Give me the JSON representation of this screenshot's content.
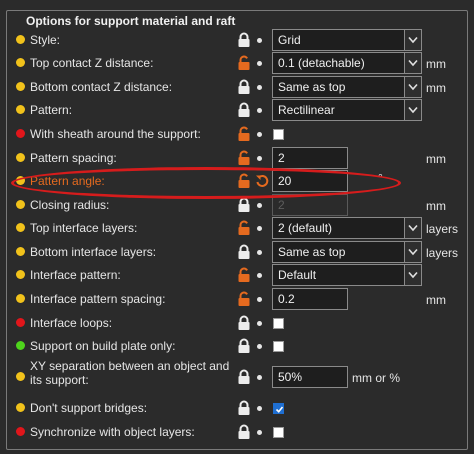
{
  "group_title": "Options for support material and raft",
  "colors": {
    "simple": "#f1c21b",
    "advanced": "#e1161b",
    "expert": "#4ed41c",
    "modified": "#e56a1f"
  },
  "rows": [
    {
      "label": "Style:",
      "dot": "simple",
      "lock": "locked",
      "control": "combo",
      "value": "Grid"
    },
    {
      "label": "Top contact Z distance:",
      "dot": "simple",
      "lock": "unlocked",
      "control": "combo",
      "value": "0.1 (detachable)",
      "unit": "mm"
    },
    {
      "label": "Bottom contact Z distance:",
      "dot": "simple",
      "lock": "locked",
      "control": "combo",
      "value": "Same as top",
      "unit": "mm"
    },
    {
      "label": "Pattern:",
      "dot": "simple",
      "lock": "locked",
      "control": "combo",
      "value": "Rectilinear"
    },
    {
      "label": "With sheath around the support:",
      "dot": "advanced",
      "lock": "unlocked",
      "control": "checkbox",
      "checked": false
    },
    {
      "label": "Pattern spacing:",
      "dot": "simple",
      "lock": "unlocked",
      "control": "text",
      "value": "2",
      "unit": "mm"
    },
    {
      "label": "Pattern angle:",
      "dot": "simple",
      "lock": "unlocked",
      "modified": true,
      "control": "text",
      "value": "20",
      "unit": "°"
    },
    {
      "label": "Closing radius:",
      "dot": "simple",
      "lock": "locked",
      "control": "text",
      "value": "2",
      "unit": "mm",
      "disabled": true
    },
    {
      "label": "Top interface layers:",
      "dot": "simple",
      "lock": "unlocked",
      "control": "combo",
      "value": "2 (default)",
      "unit": "layers"
    },
    {
      "label": "Bottom interface layers:",
      "dot": "simple",
      "lock": "locked",
      "control": "combo",
      "value": "Same as top",
      "unit": "layers"
    },
    {
      "label": "Interface pattern:",
      "dot": "simple",
      "lock": "unlocked",
      "control": "combo",
      "value": "Default"
    },
    {
      "label": "Interface pattern spacing:",
      "dot": "simple",
      "lock": "unlocked",
      "control": "text",
      "value": "0.2",
      "unit": "mm"
    },
    {
      "label": "Interface loops:",
      "dot": "advanced",
      "lock": "locked",
      "control": "checkbox",
      "checked": false
    },
    {
      "label": "Support on build plate only:",
      "dot": "expert",
      "lock": "locked",
      "control": "checkbox",
      "checked": false
    },
    {
      "label": "XY separation between an object and its support:",
      "dot": "simple",
      "lock": "locked",
      "control": "text",
      "value": "50%",
      "unit": "mm or %"
    },
    {
      "label": "Don't support bridges:",
      "dot": "simple",
      "lock": "locked",
      "control": "checkbox",
      "checked": true
    },
    {
      "label": "Synchronize with object layers:",
      "dot": "advanced",
      "lock": "locked",
      "control": "checkbox",
      "checked": false
    }
  ]
}
